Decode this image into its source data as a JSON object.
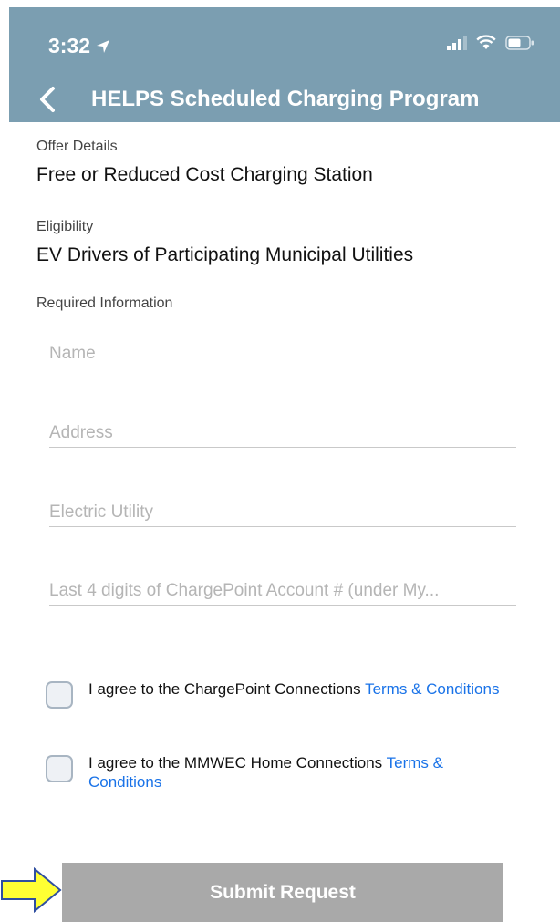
{
  "status_bar": {
    "time": "3:32",
    "location_icon": "location-arrow-icon",
    "signal_icon": "signal-bars-icon",
    "wifi_icon": "wifi-icon",
    "battery_icon": "battery-icon"
  },
  "nav": {
    "back_icon": "chevron-left-icon",
    "title": "HELPS Scheduled Charging Program"
  },
  "offer": {
    "label": "Offer Details",
    "value": "Free or Reduced Cost Charging Station"
  },
  "eligibility": {
    "label": "Eligibility",
    "value": "EV Drivers of Participating Municipal Utilities"
  },
  "required": {
    "label": "Required Information",
    "fields": [
      {
        "placeholder": "Name",
        "value": ""
      },
      {
        "placeholder": "Address",
        "value": ""
      },
      {
        "placeholder": "Electric Utility",
        "value": ""
      },
      {
        "placeholder": "Last 4 digits of ChargePoint Account # (under My...",
        "value": ""
      }
    ]
  },
  "agreements": [
    {
      "text": "I agree to the ChargePoint Connections ",
      "link": "Terms & Conditions",
      "checked": false
    },
    {
      "text": "I agree to the MMWEC Home Connections ",
      "link": "Terms & Conditions",
      "checked": false
    }
  ],
  "submit_label": "Submit Request",
  "colors": {
    "header": "#7b9eb1",
    "link": "#1a73e8",
    "submit_disabled": "#a9a9a9",
    "arrow_fill": "#ffff33",
    "arrow_stroke": "#2f4fa0"
  }
}
